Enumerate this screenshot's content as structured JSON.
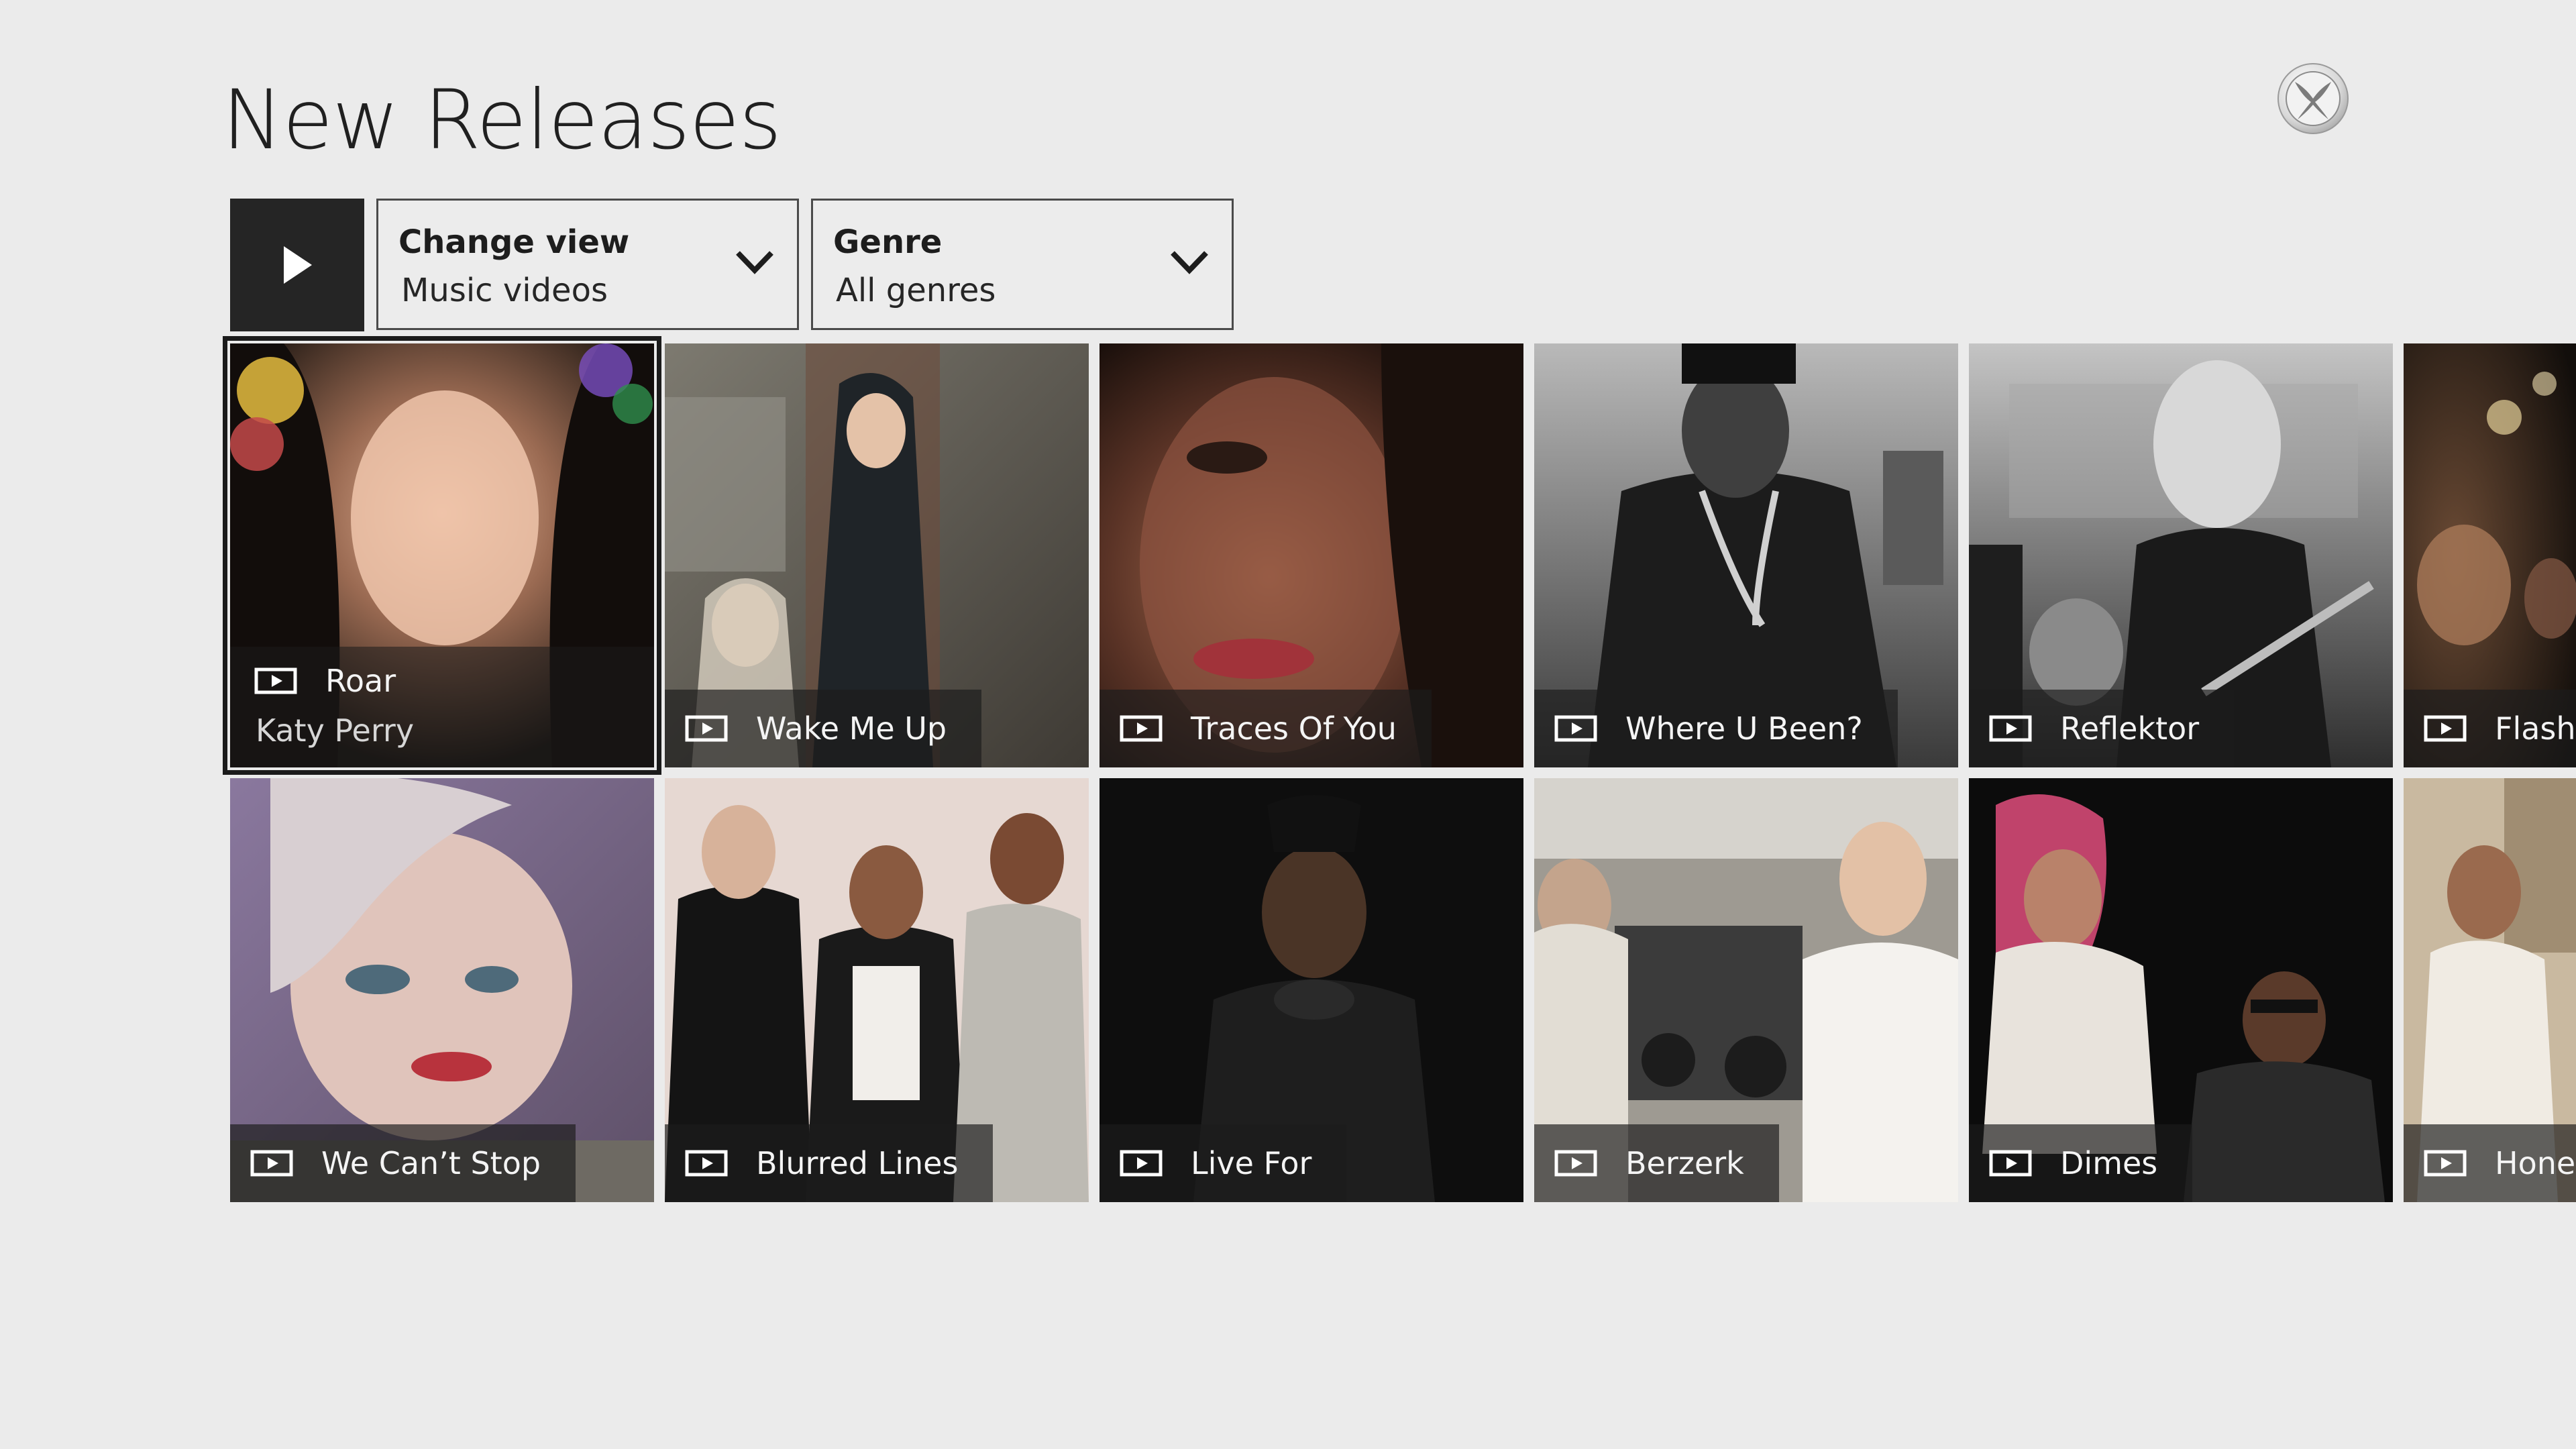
{
  "page": {
    "title": "New Releases"
  },
  "controls": {
    "play_all_icon": "play-icon",
    "change_view": {
      "label": "Change view",
      "value": "Music videos"
    },
    "genre": {
      "label": "Genre",
      "value": "All genres"
    }
  },
  "system": {
    "logo_icon": "xbox-logo-icon"
  },
  "colors": {
    "background": "#ebebeb",
    "caption_overlay": "#1c1c1c",
    "play_button": "#252525",
    "focus_outline": "#1b1b1b"
  },
  "videos": [
    {
      "title": "Roar",
      "artist": "Katy Perry",
      "focused": true,
      "icon": "video-icon"
    },
    {
      "title": "Wake Me Up",
      "icon": "video-icon"
    },
    {
      "title": "Traces Of You",
      "icon": "video-icon"
    },
    {
      "title": "Where U Been?",
      "icon": "video-icon"
    },
    {
      "title": "Reflektor",
      "icon": "video-icon"
    },
    {
      "title": "Flashb",
      "icon": "video-icon"
    },
    {
      "title": "We Can’t Stop",
      "icon": "video-icon"
    },
    {
      "title": "Blurred Lines",
      "icon": "video-icon"
    },
    {
      "title": "Live For",
      "icon": "video-icon"
    },
    {
      "title": "Berzerk",
      "icon": "video-icon"
    },
    {
      "title": "Dimes",
      "icon": "video-icon"
    },
    {
      "title": "Hones",
      "icon": "video-icon"
    }
  ]
}
